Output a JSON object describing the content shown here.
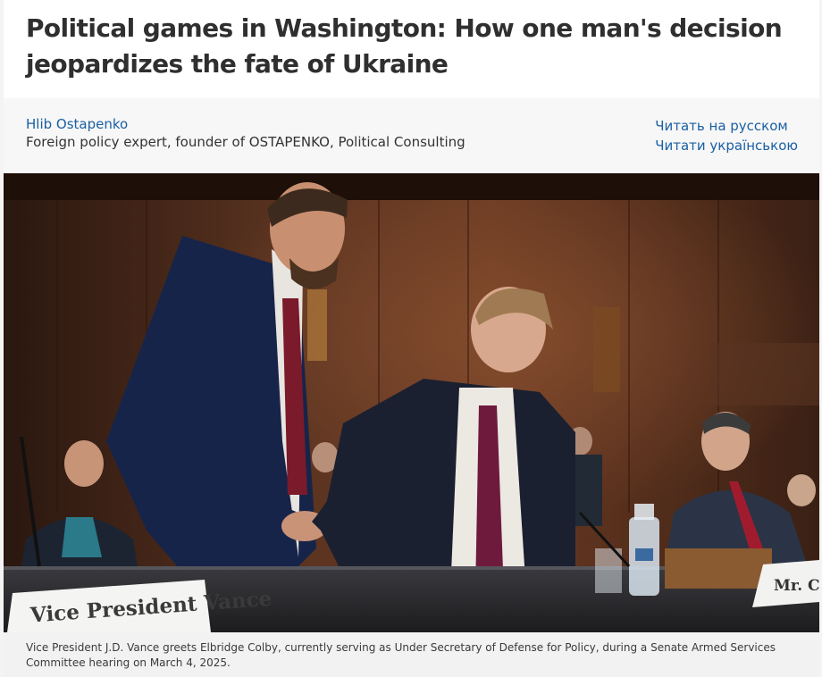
{
  "article": {
    "headline": "Political games in Washington: How one man's decision jeopardizes the fate of Ukraine"
  },
  "byline": {
    "author_name": "Hlib Ostapenko",
    "author_bio": "Foreign policy expert, founder of OSTAPENKO, Political Consulting",
    "lang_links": [
      "Читать на русском",
      "Читати українською"
    ]
  },
  "photo": {
    "nameplate_left": "Vice President Vance",
    "nameplate_right": "Mr. C",
    "caption": "Vice President J.D. Vance greets Elbridge Colby, currently serving as Under Secretary of Defense for Policy, during a Senate Armed Services Committee hearing on March 4, 2025."
  },
  "colors": {
    "link": "#1a5fa3",
    "headline": "#2f2f2f",
    "paneling": "#4a2a1c"
  }
}
